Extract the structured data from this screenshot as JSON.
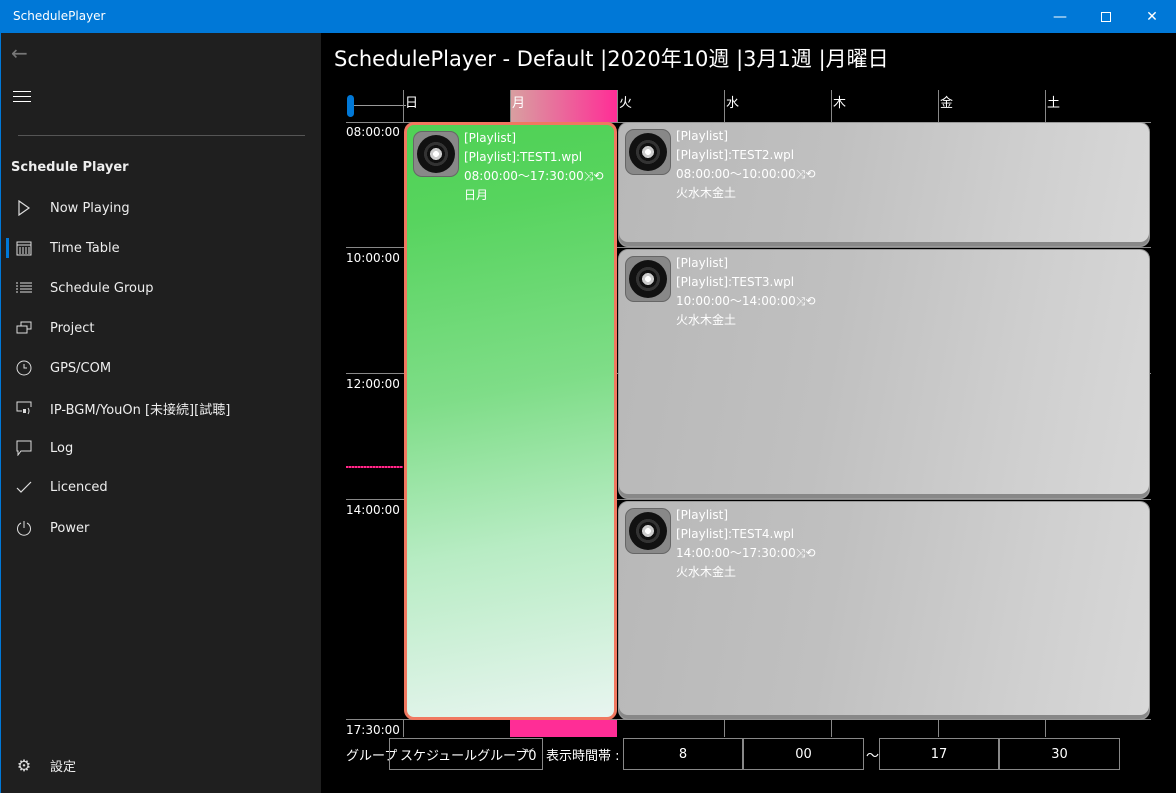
{
  "window": {
    "title": "SchedulePlayer",
    "minimize_icon": "minimize-icon",
    "maximize_icon": "maximize-icon",
    "close_icon": "close-icon",
    "accent_color": "#0078d7"
  },
  "sidebar": {
    "back_icon": "back-arrow-icon",
    "menu_icon": "hamburger-icon",
    "section_title": "Schedule Player",
    "items": [
      {
        "label": "Now Playing",
        "icon": "play-icon",
        "selected": false
      },
      {
        "label": "Time Table",
        "icon": "calendar-icon",
        "selected": true
      },
      {
        "label": "Schedule Group",
        "icon": "list-icon",
        "selected": false
      },
      {
        "label": "Project",
        "icon": "project-icon",
        "selected": false
      },
      {
        "label": "GPS/COM",
        "icon": "clock-icon",
        "selected": false
      },
      {
        "label": "IP-BGM/YouOn [未接続][試聴]",
        "icon": "cast-icon",
        "selected": false
      },
      {
        "label": "Log",
        "icon": "chat-icon",
        "selected": false
      },
      {
        "label": "Licenced",
        "icon": "check-icon",
        "selected": false
      },
      {
        "label": "Power",
        "icon": "power-icon",
        "selected": false
      }
    ],
    "settings": {
      "label": "設定",
      "icon": "gear-icon"
    }
  },
  "main": {
    "title": "SchedulePlayer - Default |2020年10週 |3月1週 |月曜日",
    "days": [
      "日",
      "月",
      "火",
      "水",
      "木",
      "金",
      "土"
    ],
    "today": "月",
    "today_color": "#ff2d96",
    "time_labels": [
      "08:00:00",
      "10:00:00",
      "12:00:00",
      "14:00:00",
      "17:30:00"
    ],
    "schedules": [
      {
        "type": "[Playlist]",
        "name": "[Playlist]:TEST1.wpl",
        "time": "08:00:00～17:30:00",
        "days": "日月",
        "style": "green",
        "icon": "vinyl-disc-icon",
        "shuffle_icon": "shuffle-icon",
        "repeat_icon": "repeat-icon"
      },
      {
        "type": "[Playlist]",
        "name": "[Playlist]:TEST2.wpl",
        "time": "08:00:00～10:00:00",
        "days": "火水木金土",
        "style": "gray",
        "icon": "vinyl-disc-icon",
        "shuffle_icon": "shuffle-icon",
        "repeat_icon": "repeat-icon"
      },
      {
        "type": "[Playlist]",
        "name": "[Playlist]:TEST3.wpl",
        "time": "10:00:00～14:00:00",
        "days": "火水木金土",
        "style": "gray",
        "icon": "vinyl-disc-icon",
        "shuffle_icon": "shuffle-icon",
        "repeat_icon": "repeat-icon"
      },
      {
        "type": "[Playlist]",
        "name": "[Playlist]:TEST4.wpl",
        "time": "14:00:00～17:30:00",
        "days": "火水木金土",
        "style": "gray",
        "icon": "vinyl-disc-icon",
        "shuffle_icon": "shuffle-icon",
        "repeat_icon": "repeat-icon"
      }
    ]
  },
  "footer": {
    "group_label": "グループ",
    "group_value": "スケジュールグループ0",
    "range_label": "表示時間帯 :",
    "start_hour": "8",
    "start_minute": "00",
    "separator": "～",
    "end_hour": "17",
    "end_minute": "30"
  }
}
